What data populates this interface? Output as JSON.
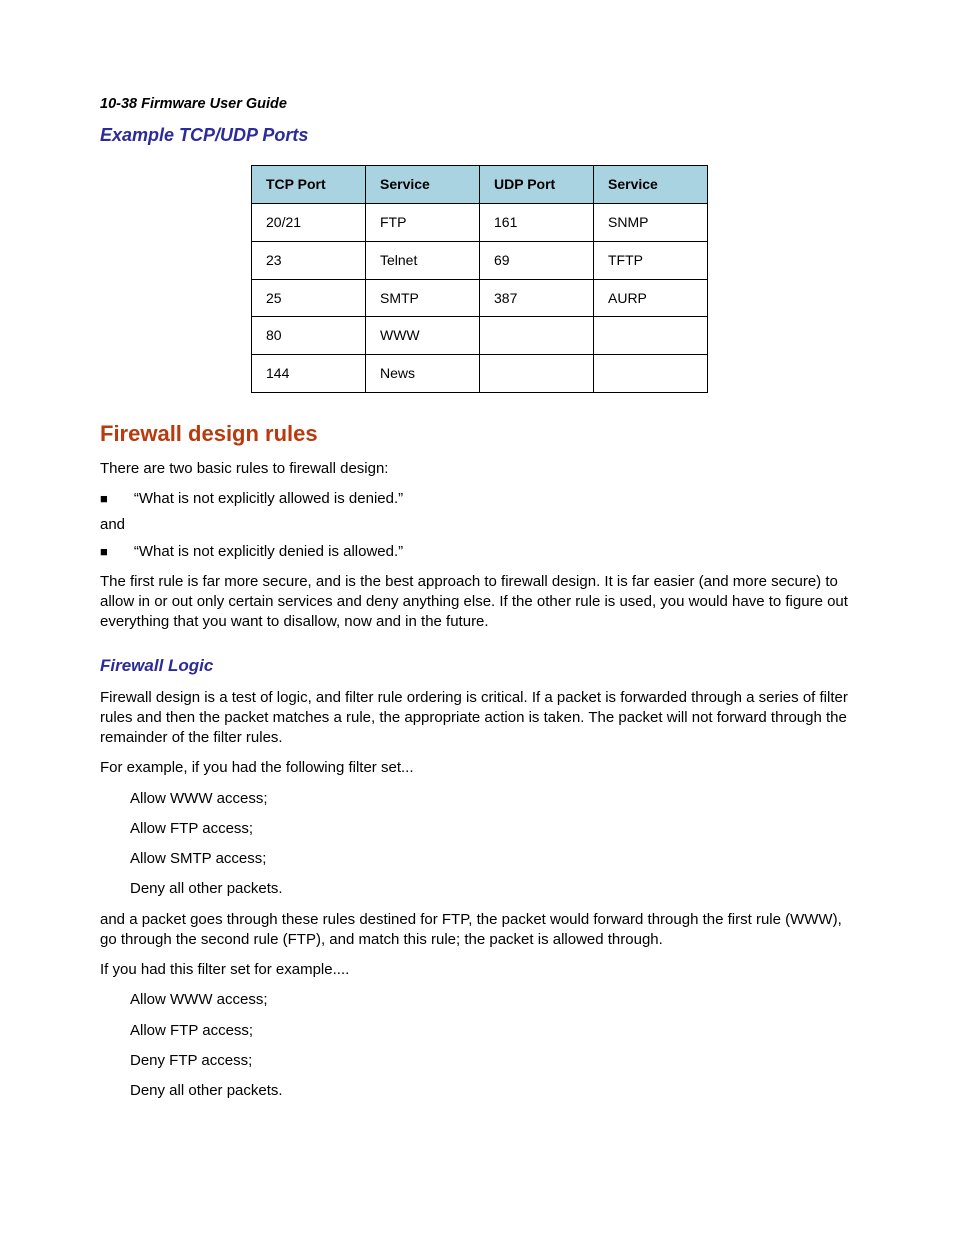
{
  "running_head": "10-38  Firmware User Guide",
  "section_title_ports": "Example TCP/UDP Ports",
  "ports_table": {
    "headers": [
      "TCP Port",
      "Service",
      "UDP Port",
      "Service"
    ],
    "rows": [
      [
        "20/21",
        "FTP",
        "161",
        "SNMP"
      ],
      [
        "23",
        "Telnet",
        "69",
        "TFTP"
      ],
      [
        "25",
        "SMTP",
        "387",
        "AURP"
      ],
      [
        "80",
        "WWW",
        "",
        ""
      ],
      [
        "144",
        "News",
        "",
        ""
      ]
    ]
  },
  "heading_firewall": "Firewall design rules",
  "intro_para": "There are two basic rules to firewall design:",
  "bullet1": "“What is not explicitly allowed is denied.”",
  "and_text": "and",
  "bullet2": "“What is not explicitly denied is allowed.”",
  "para_secure": "The first rule is far more secure, and is the best approach to firewall design. It is far easier (and more secure) to allow in or out only certain services and deny anything else. If the other rule is used, you would have to figure out everything that you want to disallow, now and in the future.",
  "heading_logic": "Firewall Logic",
  "para_logic": "Firewall design is a test of logic, and filter rule ordering is critical. If a packet is forwarded through a series of filter rules and then the packet matches a rule, the appropriate action is taken. The packet will not forward through the remainder of the filter rules.",
  "para_example_intro": "For example, if you had the following filter set...",
  "filter_set_1": [
    "Allow WWW access;",
    "Allow FTP access;",
    "Allow SMTP access;",
    "Deny all other packets."
  ],
  "para_explain": "and a packet goes through these rules destined for FTP, the packet would forward through the first rule (WWW), go through the second rule (FTP), and match this rule; the packet is allowed through.",
  "para_second_intro": "If you had this filter set for example....",
  "filter_set_2": [
    "Allow WWW access;",
    "Allow FTP access;",
    "Deny FTP access;",
    "Deny all other packets."
  ]
}
